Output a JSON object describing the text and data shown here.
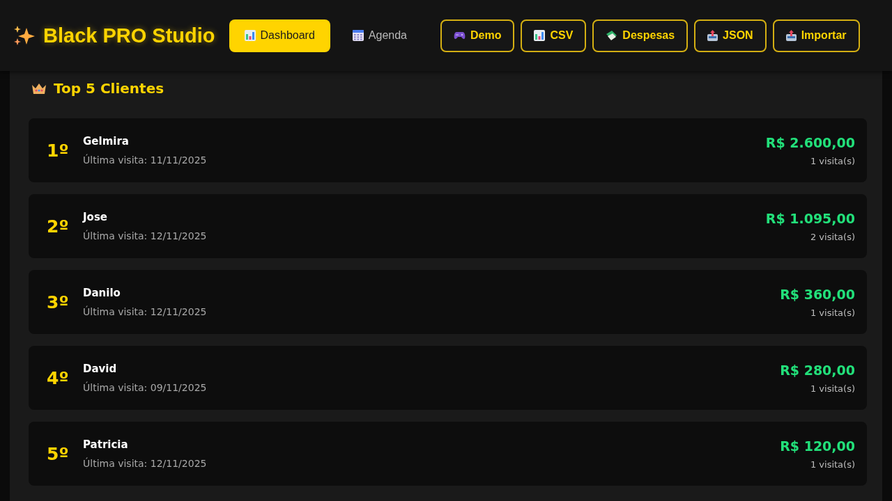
{
  "app": {
    "title": "Black PRO Studio"
  },
  "tabs": [
    {
      "label": "Dashboard",
      "selected": true
    },
    {
      "label": "Agenda",
      "selected": false
    }
  ],
  "actions": [
    "Demo",
    "CSV",
    "Despesas",
    "JSON",
    "Importar"
  ],
  "section": {
    "title": "Top 5 Clientes"
  },
  "clients": [
    {
      "rank": "1º",
      "name": "Gelmira",
      "last_visit": "Última visita: 11/11/2025",
      "total": "R$ 2.600,00",
      "visits": "1 visita(s)"
    },
    {
      "rank": "2º",
      "name": "Jose",
      "last_visit": "Última visita: 12/11/2025",
      "total": "R$ 1.095,00",
      "visits": "2 visita(s)"
    },
    {
      "rank": "3º",
      "name": "Danilo",
      "last_visit": "Última visita: 12/11/2025",
      "total": "R$ 360,00",
      "visits": "1 visita(s)"
    },
    {
      "rank": "4º",
      "name": "David",
      "last_visit": "Última visita: 09/11/2025",
      "total": "R$ 280,00",
      "visits": "1 visita(s)"
    },
    {
      "rank": "5º",
      "name": "Patricia",
      "last_visit": "Última visita: 12/11/2025",
      "total": "R$ 120,00",
      "visits": "1 visita(s)"
    }
  ]
}
